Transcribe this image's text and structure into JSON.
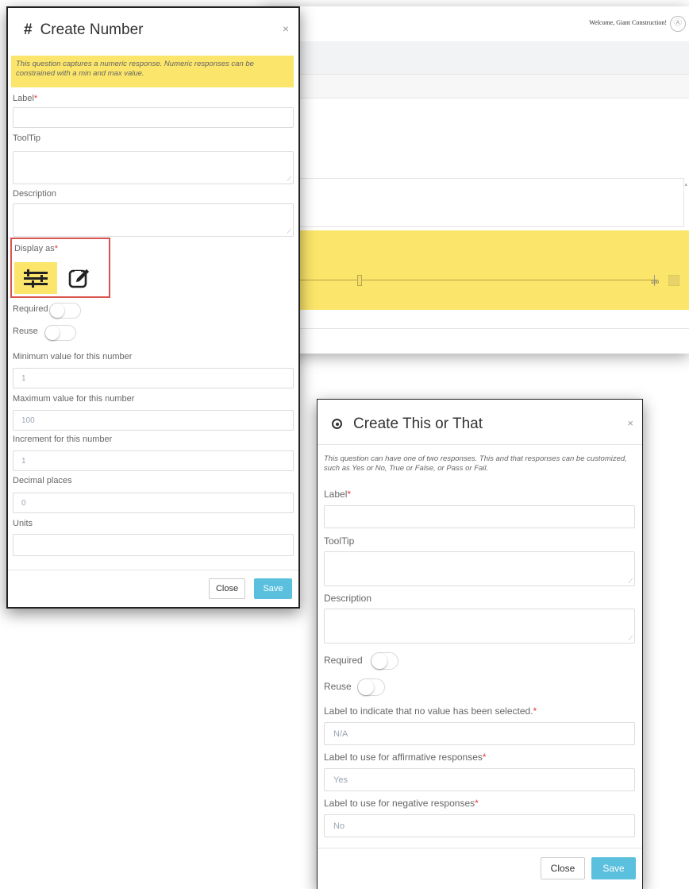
{
  "background_app": {
    "welcome_text": "Welcome, Giant Construction!",
    "avatar_glyph": "Ⓐ",
    "slider_max_label": "100"
  },
  "create_number": {
    "title": "Create Number",
    "title_icon": "#",
    "close_glyph": "×",
    "info": "This question captures a numeric response. Numeric responses can be constrained with a min and max value.",
    "label_label": "Label",
    "tooltip_label": "ToolTip",
    "description_label": "Description",
    "display_as_label": "Display as",
    "display_options": [
      "slider-icon",
      "edit-icon"
    ],
    "required_label": "Required",
    "reuse_label": "Reuse",
    "min_label": "Minimum value for this number",
    "min_value": "1",
    "max_label": "Maximum value for this number",
    "max_value": "100",
    "increment_label": "Increment for this number",
    "increment_value": "1",
    "decimal_label": "Decimal places",
    "decimal_value": "0",
    "units_label": "Units",
    "units_value": "",
    "close_button": "Close",
    "save_button": "Save",
    "accent_color": "#fbe56a",
    "highlight_border_color": "#d9534f"
  },
  "create_this_or_that": {
    "title": "Create This or That",
    "close_glyph": "×",
    "info": "This question can have one of two responses. This and that responses can be customized, such as Yes or No, True or False, or Pass or Fail.",
    "label_label": "Label",
    "tooltip_label": "ToolTip",
    "description_label": "Description",
    "required_label": "Required",
    "reuse_label": "Reuse",
    "no_value_label": "Label to indicate that no value has been selected.",
    "no_value_value": "N/A",
    "affirmative_label": "Label to use for affirmative responses",
    "affirmative_value": "Yes",
    "negative_label": "Label to use for negative responses",
    "negative_value": "No",
    "close_button": "Close",
    "save_button": "Save",
    "save_color": "#5bc0de"
  },
  "required_marker": "*"
}
